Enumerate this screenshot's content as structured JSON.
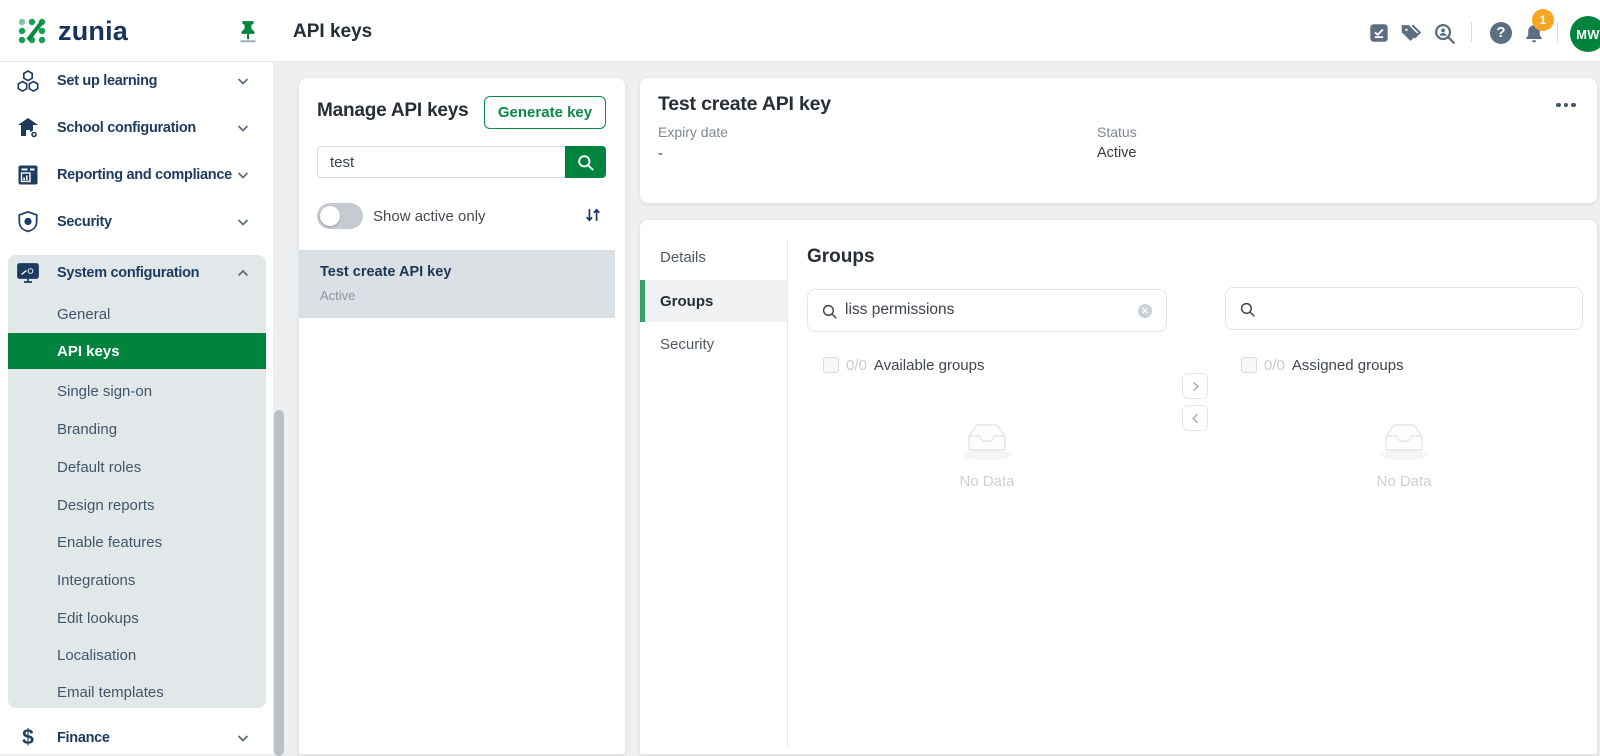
{
  "brand": {
    "name": "zunia"
  },
  "header": {
    "title": "API keys",
    "notification_count": "1",
    "avatar_initials": "MW"
  },
  "sidebar": {
    "items": [
      {
        "label": "Set up learning"
      },
      {
        "label": "School configuration"
      },
      {
        "label": "Reporting and compliance"
      },
      {
        "label": "Security"
      },
      {
        "label": "System configuration"
      },
      {
        "label": "Finance"
      }
    ],
    "children": [
      "General",
      "API keys",
      "Single sign-on",
      "Branding",
      "Default roles",
      "Design reports",
      "Enable features",
      "Integrations",
      "Edit lookups",
      "Localisation",
      "Email templates"
    ],
    "active_child": "API keys"
  },
  "keys_panel": {
    "title": "Manage API keys",
    "generate_label": "Generate key",
    "search_value": "test",
    "toggle_label": "Show active only",
    "list": [
      {
        "name": "Test create API key",
        "status": "Active"
      }
    ]
  },
  "detail": {
    "title": "Test create API key",
    "expiry_label": "Expiry date",
    "expiry_value": "-",
    "status_label": "Status",
    "status_value": "Active"
  },
  "tabs": {
    "details": "Details",
    "groups": "Groups",
    "security": "Security"
  },
  "groups_panel": {
    "heading": "Groups",
    "available_search_value": "liss permissions",
    "assigned_search_value": "",
    "available_count": "0/0",
    "available_label": "Available groups",
    "assigned_count": "0/0",
    "assigned_label": "Assigned groups",
    "empty_text": "No Data"
  }
}
